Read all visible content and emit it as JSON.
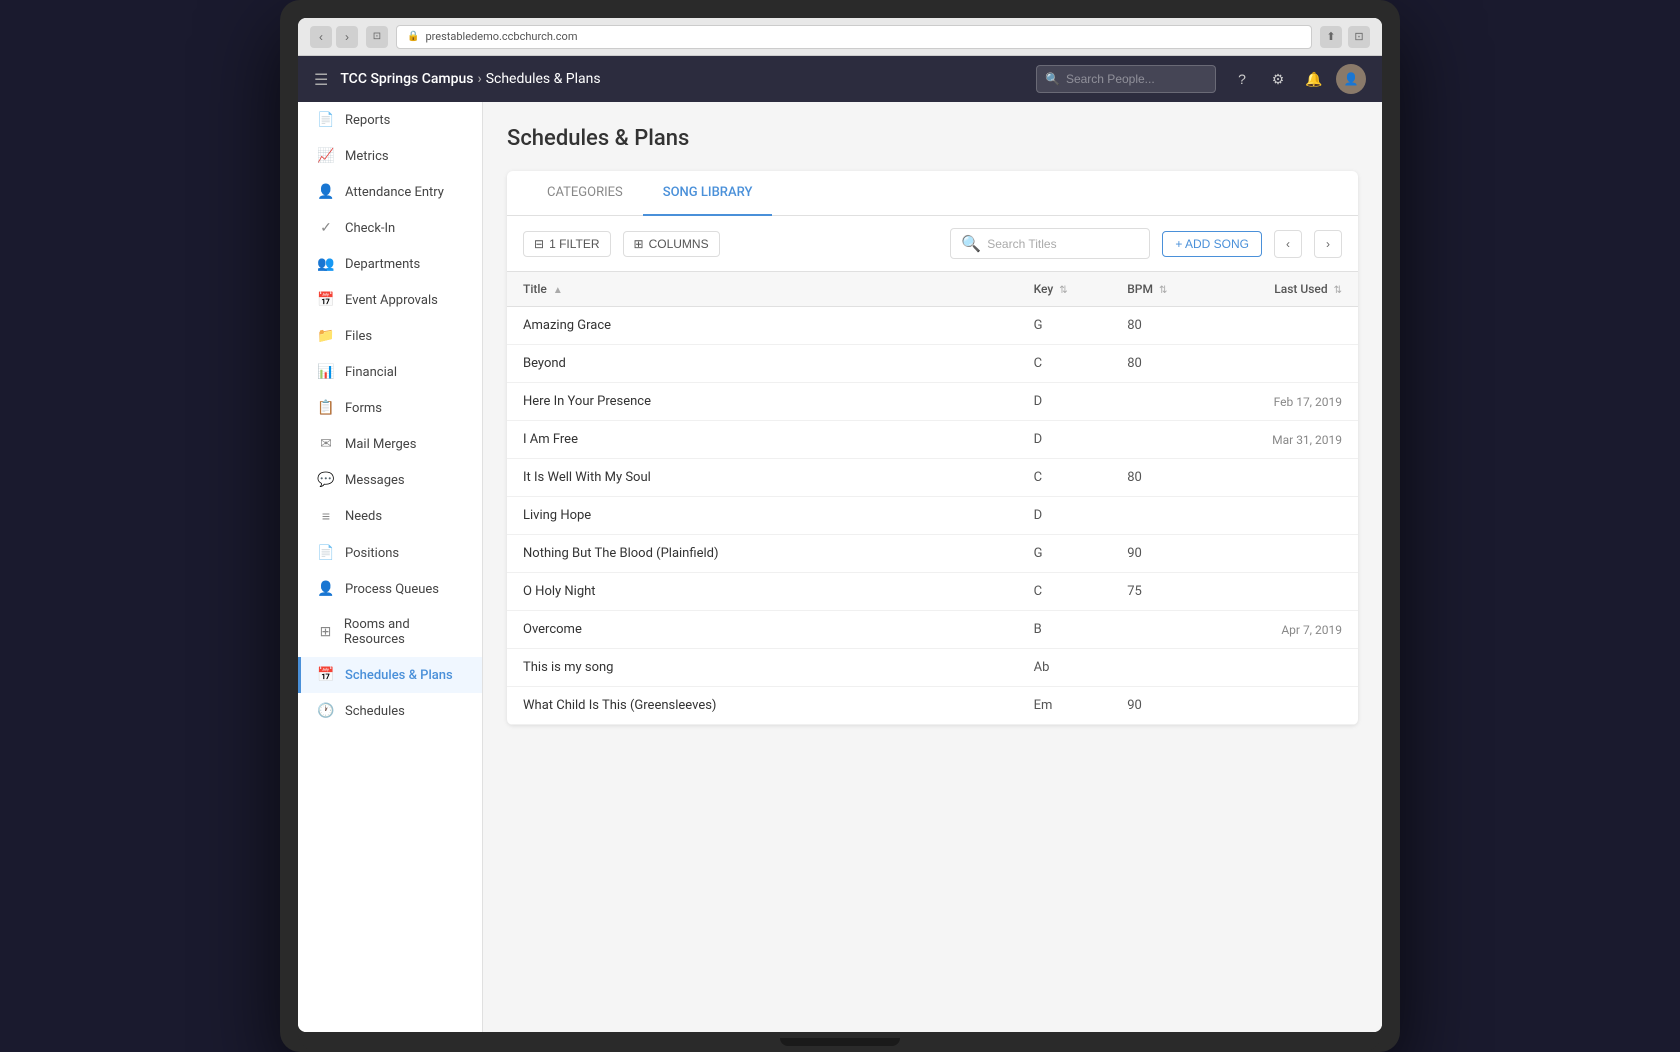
{
  "browser": {
    "url": "prestabledemo.ccbchurch.com",
    "back_label": "‹",
    "forward_label": "›"
  },
  "header": {
    "menu_icon": "☰",
    "org_name": "TCC Springs Campus",
    "separator": "›",
    "section": "Schedules & Plans",
    "search_placeholder": "Search People...",
    "help_icon": "?",
    "settings_icon": "⚙",
    "notifications_icon": "🔔",
    "avatar_initials": "U"
  },
  "sidebar": {
    "items": [
      {
        "id": "reports",
        "icon": "📄",
        "label": "Reports"
      },
      {
        "id": "metrics",
        "icon": "📈",
        "label": "Metrics"
      },
      {
        "id": "attendance",
        "icon": "👤",
        "label": "Attendance Entry"
      },
      {
        "id": "checkin",
        "icon": "✓",
        "label": "Check-In"
      },
      {
        "id": "departments",
        "icon": "👥",
        "label": "Departments"
      },
      {
        "id": "event-approvals",
        "icon": "📅",
        "label": "Event Approvals"
      },
      {
        "id": "files",
        "icon": "📁",
        "label": "Files"
      },
      {
        "id": "financial",
        "icon": "📊",
        "label": "Financial"
      },
      {
        "id": "forms",
        "icon": "📋",
        "label": "Forms"
      },
      {
        "id": "mail-merges",
        "icon": "✉",
        "label": "Mail Merges"
      },
      {
        "id": "messages",
        "icon": "💬",
        "label": "Messages"
      },
      {
        "id": "needs",
        "icon": "≡",
        "label": "Needs"
      },
      {
        "id": "positions",
        "icon": "📄",
        "label": "Positions"
      },
      {
        "id": "process-queues",
        "icon": "👤",
        "label": "Process Queues"
      },
      {
        "id": "rooms",
        "icon": "⊞",
        "label": "Rooms and Resources"
      },
      {
        "id": "schedules-plans",
        "icon": "📅",
        "label": "Schedules & Plans",
        "active": true
      },
      {
        "id": "schedules",
        "icon": "🕐",
        "label": "Schedules"
      }
    ]
  },
  "page": {
    "title": "Schedules & Plans"
  },
  "tabs": [
    {
      "id": "categories",
      "label": "CATEGORIES",
      "active": false
    },
    {
      "id": "song-library",
      "label": "SONG LIBRARY",
      "active": true
    }
  ],
  "toolbar": {
    "filter_label": "1 FILTER",
    "columns_label": "COLUMNS",
    "search_placeholder": "Search Titles",
    "add_song_label": "+ ADD SONG",
    "prev_icon": "‹",
    "next_icon": "›"
  },
  "table": {
    "columns": [
      {
        "id": "title",
        "label": "Title",
        "sortable": true
      },
      {
        "id": "key",
        "label": "Key",
        "sortable": true
      },
      {
        "id": "bpm",
        "label": "BPM",
        "sortable": true
      },
      {
        "id": "last_used",
        "label": "Last Used",
        "sortable": true
      }
    ],
    "rows": [
      {
        "title": "Amazing Grace",
        "key": "G",
        "bpm": "80",
        "last_used": ""
      },
      {
        "title": "Beyond",
        "key": "C",
        "bpm": "80",
        "last_used": ""
      },
      {
        "title": "Here In Your Presence",
        "key": "D",
        "bpm": "",
        "last_used": "Feb 17, 2019"
      },
      {
        "title": "I Am Free",
        "key": "D",
        "bpm": "",
        "last_used": "Mar 31, 2019"
      },
      {
        "title": "It Is Well With My Soul",
        "key": "C",
        "bpm": "80",
        "last_used": ""
      },
      {
        "title": "Living Hope",
        "key": "D",
        "bpm": "",
        "last_used": ""
      },
      {
        "title": "Nothing But The Blood (Plainfield)",
        "key": "G",
        "bpm": "90",
        "last_used": ""
      },
      {
        "title": "O Holy Night",
        "key": "C",
        "bpm": "75",
        "last_used": ""
      },
      {
        "title": "Overcome",
        "key": "B",
        "bpm": "",
        "last_used": "Apr 7, 2019"
      },
      {
        "title": "This is my song",
        "key": "Ab",
        "bpm": "",
        "last_used": ""
      },
      {
        "title": "What Child Is This (Greensleeves)",
        "key": "Em",
        "bpm": "90",
        "last_used": ""
      }
    ]
  }
}
